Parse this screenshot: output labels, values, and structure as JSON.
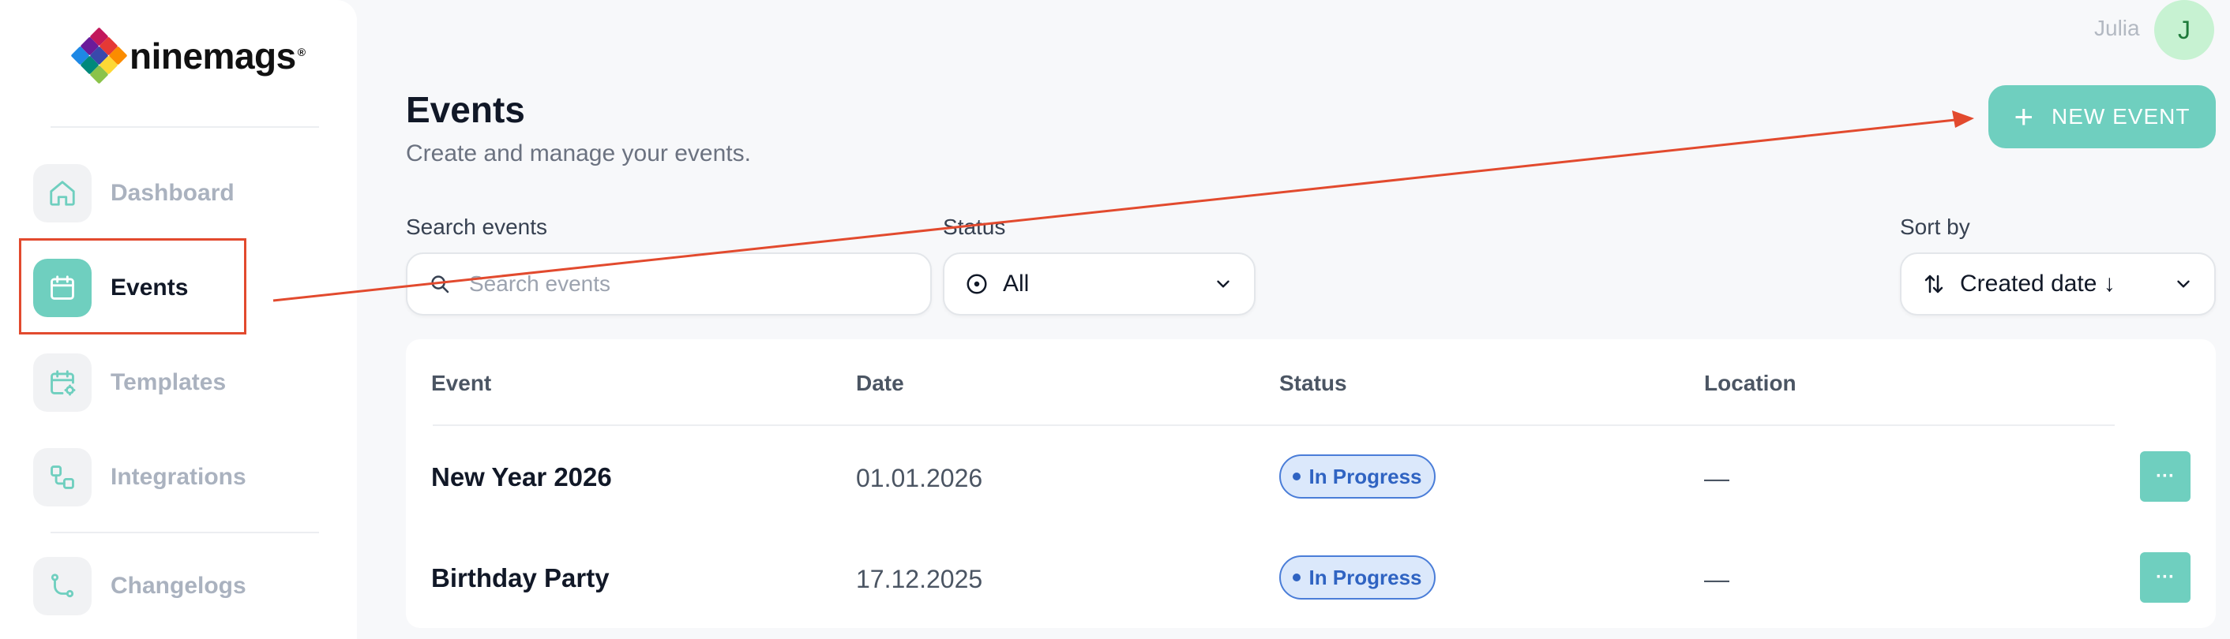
{
  "brand": {
    "name": "ninemags",
    "registered": "®"
  },
  "sidebar": {
    "items": [
      {
        "label": "Dashboard",
        "icon": "home-icon",
        "active": false
      },
      {
        "label": "Events",
        "icon": "calendar-icon",
        "active": true
      },
      {
        "label": "Templates",
        "icon": "calendar-gear-icon",
        "active": false
      },
      {
        "label": "Integrations",
        "icon": "workflow-icon",
        "active": false
      },
      {
        "label": "Changelogs",
        "icon": "git-branch-icon",
        "active": false
      }
    ]
  },
  "user": {
    "name": "Julia",
    "initial": "J"
  },
  "header": {
    "title": "Events",
    "subtitle": "Create and manage your events.",
    "new_event_label": "NEW EVENT"
  },
  "filters": {
    "search_label": "Search events",
    "search_placeholder": "Search events",
    "status_label": "Status",
    "status_value": "All",
    "sort_label": "Sort by",
    "sort_value": "Created date ↓"
  },
  "table": {
    "columns": [
      "Event",
      "Date",
      "Status",
      "Location"
    ],
    "rows": [
      {
        "event": "New Year 2026",
        "date": "01.01.2026",
        "status": "In Progress",
        "location": "—",
        "menu": "···"
      },
      {
        "event": "Birthday Party",
        "date": "17.12.2025",
        "status": "In Progress",
        "location": "—",
        "menu": "···"
      }
    ]
  },
  "colors": {
    "accent": "#6fcfbf",
    "annotation": "#e24a2e",
    "status_in_progress": "#2f63c2"
  }
}
